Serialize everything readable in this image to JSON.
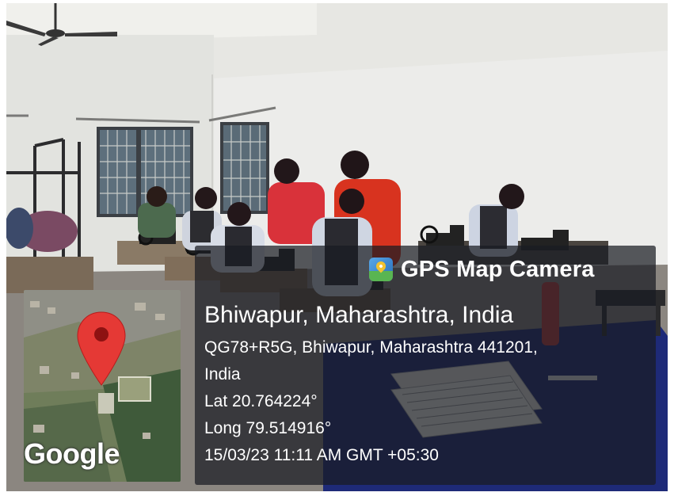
{
  "brand": {
    "name": "GPS Map Camera",
    "icon": "map-pin-icon"
  },
  "location": {
    "place": "Bhiwapur, Maharashtra, India",
    "address_line1": "QG78+R5G, Bhiwapur, Maharashtra 441201,",
    "address_line2": "India",
    "lat": "Lat 20.764224°",
    "long": "Long 79.514916°",
    "datetime": "15/03/23 11:11 AM GMT +05:30"
  },
  "map": {
    "attribution": "Google",
    "pin_color": "#e53935"
  }
}
